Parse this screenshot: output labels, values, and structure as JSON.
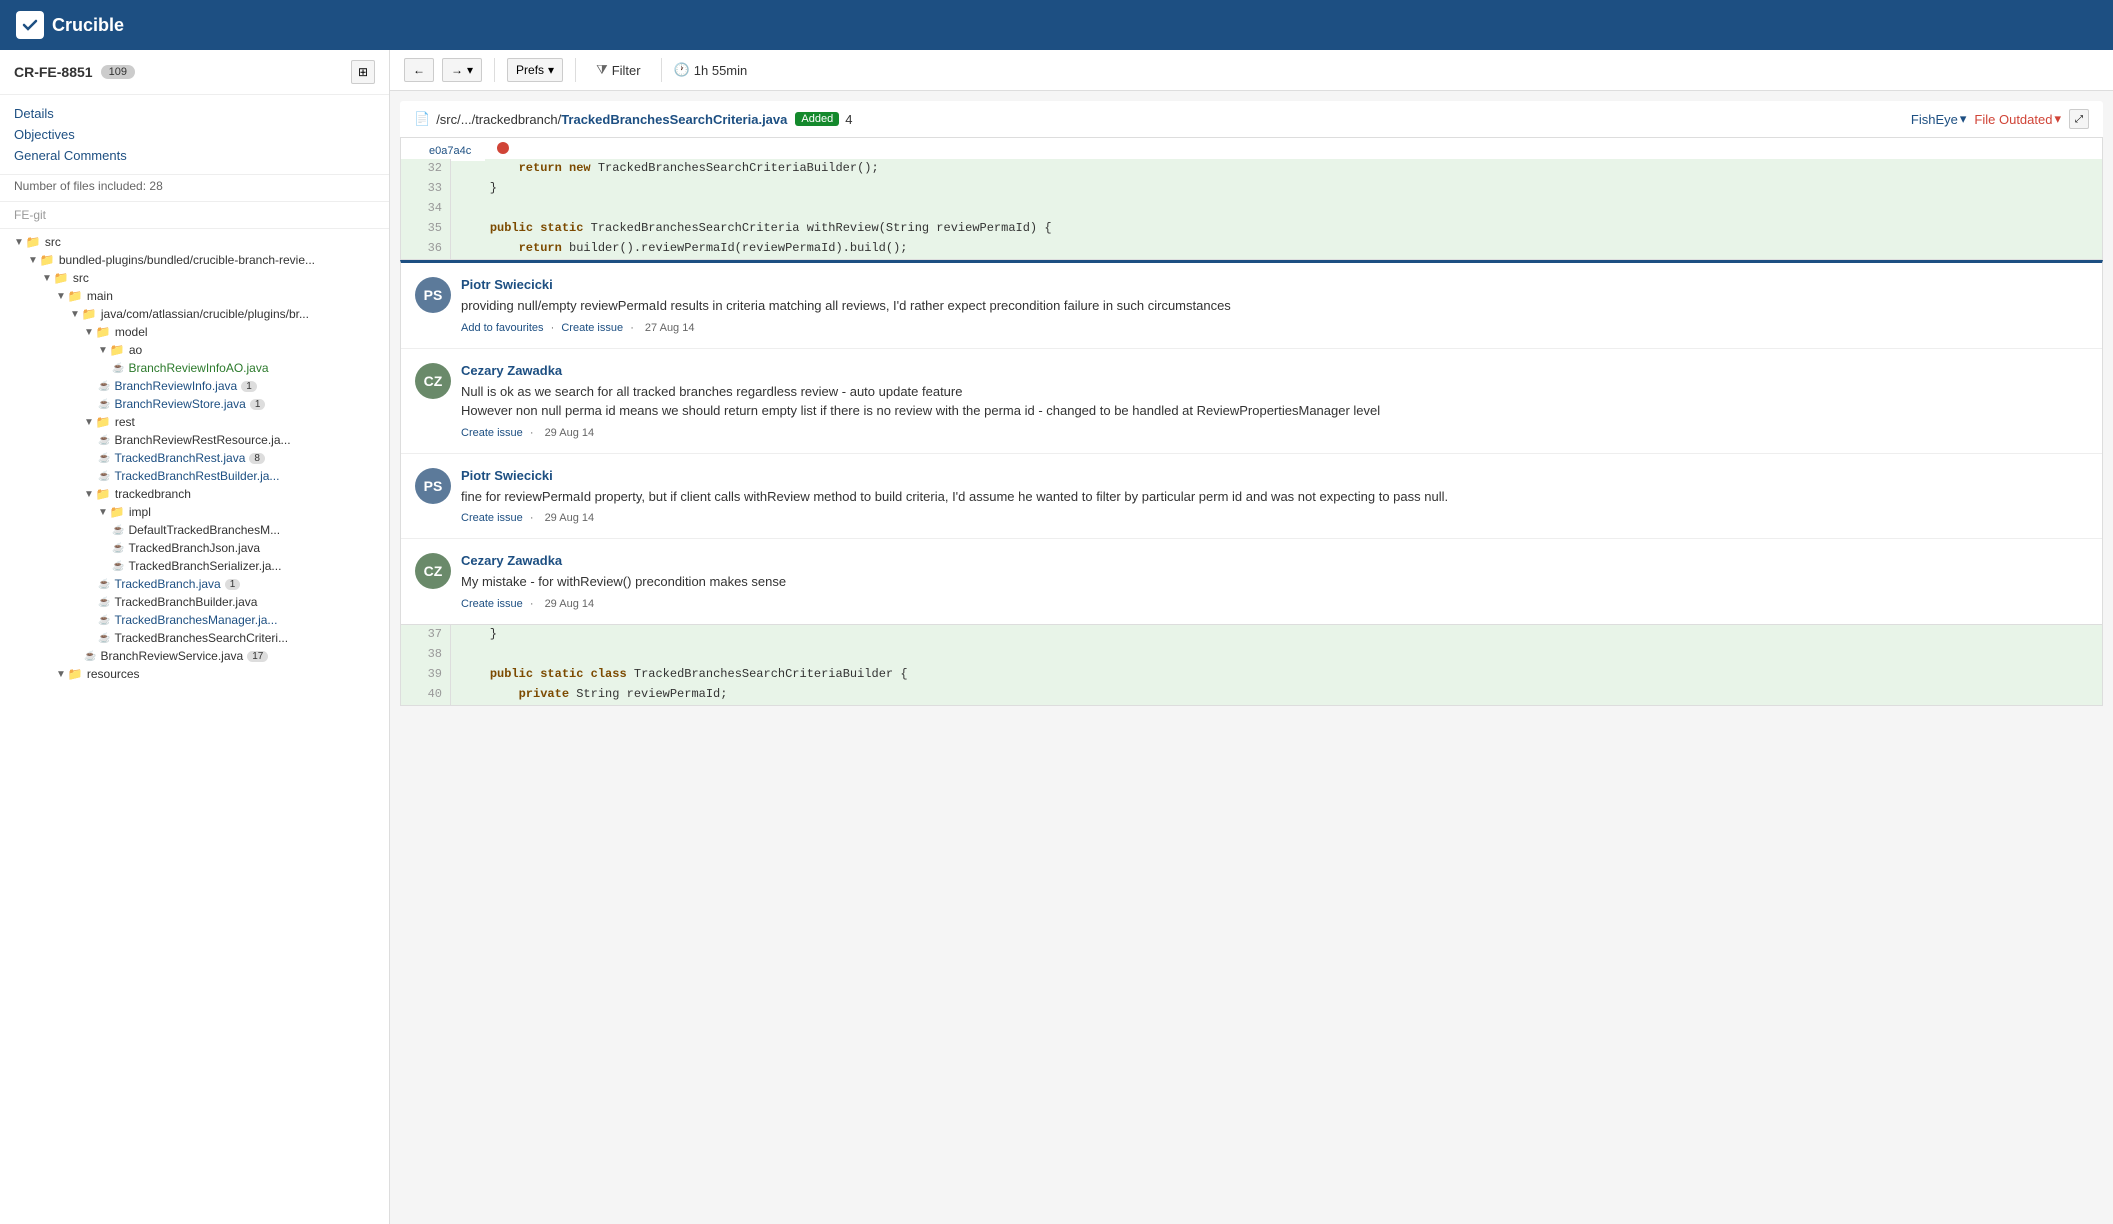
{
  "app": {
    "name": "Crucible",
    "logo_text": "✔"
  },
  "sidebar": {
    "review_id": "CR-FE-8851",
    "review_count": "109",
    "nav_links": [
      {
        "label": "Details",
        "href": "#"
      },
      {
        "label": "Objectives",
        "href": "#"
      },
      {
        "label": "General Comments",
        "href": "#"
      }
    ],
    "meta": "Number of files included: 28",
    "repo": "FE-git",
    "tree": [
      {
        "indent": 1,
        "type": "folder",
        "label": "src",
        "toggle": "▼"
      },
      {
        "indent": 2,
        "type": "folder",
        "label": "bundled-plugins/bundled/crucible-branch-revie...",
        "toggle": "▼"
      },
      {
        "indent": 3,
        "type": "folder",
        "label": "src",
        "toggle": "▼"
      },
      {
        "indent": 4,
        "type": "folder",
        "label": "main",
        "toggle": "▼"
      },
      {
        "indent": 5,
        "type": "folder",
        "label": "java/com/atlassian/crucible/plugins/br...",
        "toggle": "▼"
      },
      {
        "indent": 6,
        "type": "folder",
        "label": "model",
        "toggle": "▼"
      },
      {
        "indent": 7,
        "type": "folder",
        "label": "ao",
        "toggle": "▼"
      },
      {
        "indent": 8,
        "type": "file",
        "label": "BranchReviewInfoAO.java",
        "color": "green",
        "badge": null
      },
      {
        "indent": 7,
        "type": "file",
        "label": "BranchReviewInfo.java",
        "color": "blue",
        "badge": "1"
      },
      {
        "indent": 7,
        "type": "file",
        "label": "BranchReviewStore.java",
        "color": "blue",
        "badge": "1"
      },
      {
        "indent": 6,
        "type": "folder",
        "label": "rest",
        "toggle": "▼"
      },
      {
        "indent": 7,
        "type": "file",
        "label": "BranchReviewRestResource.ja...",
        "color": "default",
        "badge": null
      },
      {
        "indent": 7,
        "type": "file",
        "label": "TrackedBranchRest.java",
        "color": "blue",
        "badge": "8"
      },
      {
        "indent": 7,
        "type": "file",
        "label": "TrackedBranchRestBuilder.ja...",
        "color": "blue",
        "badge": null
      },
      {
        "indent": 6,
        "type": "folder",
        "label": "trackedbranch",
        "toggle": "▼"
      },
      {
        "indent": 7,
        "type": "folder",
        "label": "impl",
        "toggle": "▼"
      },
      {
        "indent": 8,
        "type": "file",
        "label": "DefaultTrackedBranchesM...",
        "color": "default",
        "badge": null
      },
      {
        "indent": 8,
        "type": "file",
        "label": "TrackedBranchJson.java",
        "color": "default",
        "badge": null
      },
      {
        "indent": 8,
        "type": "file",
        "label": "TrackedBranchSerializer.ja...",
        "color": "default",
        "badge": null
      },
      {
        "indent": 7,
        "type": "file",
        "label": "TrackedBranch.java",
        "color": "blue",
        "badge": "1"
      },
      {
        "indent": 7,
        "type": "file",
        "label": "TrackedBranchBuilder.java",
        "color": "default",
        "badge": null
      },
      {
        "indent": 7,
        "type": "file",
        "label": "TrackedBranchesManager.ja...",
        "color": "blue",
        "badge": null
      },
      {
        "indent": 7,
        "type": "file",
        "label": "TrackedBranchesSearchCriteri...",
        "color": "default",
        "badge": null
      },
      {
        "indent": 6,
        "type": "file",
        "label": "BranchReviewService.java",
        "color": "default",
        "badge": "17"
      },
      {
        "indent": 4,
        "type": "folder",
        "label": "resources",
        "toggle": "▼"
      }
    ]
  },
  "toolbar": {
    "prefs_label": "Prefs",
    "filter_label": "Filter",
    "time_label": "1h 55min"
  },
  "file_header": {
    "path_prefix": "/src/.../trackedbranch/",
    "filename": "TrackedBranchesSearchCriteria.java",
    "badge": "Added",
    "count": "4",
    "fisheye_label": "FishEye",
    "file_outdated_label": "File Outdated"
  },
  "commit": {
    "hash": "e0a7a4c"
  },
  "code_lines_top": [
    {
      "num": "32",
      "content": "        return new TrackedBranchesSearchCriteriaBuilder();"
    },
    {
      "num": "33",
      "content": "    }"
    },
    {
      "num": "34",
      "content": ""
    },
    {
      "num": "35",
      "content": "    public static TrackedBranchesSearchCriteria withReview(String reviewPermaId) {"
    },
    {
      "num": "36",
      "content": "        return builder().reviewPermaId(reviewPermaId).build();"
    }
  ],
  "comments": [
    {
      "author": "Piotr Swiecicki",
      "avatar_initials": "PS",
      "avatar_class": "avatar-ps",
      "text": "providing null/empty reviewPermaId results in criteria matching all reviews, I'd rather expect precondition failure in such circumstances",
      "actions": [
        {
          "label": "Add to favourites",
          "type": "link"
        },
        {
          "label": "·",
          "type": "sep"
        },
        {
          "label": "Create issue",
          "type": "link"
        },
        {
          "label": "·",
          "type": "sep"
        },
        {
          "label": "27 Aug 14",
          "type": "text"
        }
      ]
    },
    {
      "author": "Cezary Zawadka",
      "avatar_initials": "CZ",
      "avatar_class": "avatar-cz",
      "text": "Null is ok as we search for all tracked branches regardless review - auto update feature\nHowever non null perma id means we should return empty list if there is no review with the perma id - changed to be handled at ReviewPropertiesManager level",
      "actions": [
        {
          "label": "Create issue",
          "type": "link"
        },
        {
          "label": "·",
          "type": "sep"
        },
        {
          "label": "29 Aug 14",
          "type": "text"
        }
      ]
    },
    {
      "author": "Piotr Swiecicki",
      "avatar_initials": "PS",
      "avatar_class": "avatar-ps",
      "text": "fine for reviewPermaId property, but if client calls withReview method to build criteria, I'd assume he wanted to filter by particular perm id and was not expecting to pass null.",
      "actions": [
        {
          "label": "Create issue",
          "type": "link"
        },
        {
          "label": "·",
          "type": "sep"
        },
        {
          "label": "29 Aug 14",
          "type": "text"
        }
      ]
    },
    {
      "author": "Cezary Zawadka",
      "avatar_initials": "CZ",
      "avatar_class": "avatar-cz",
      "text": "My mistake - for withReview() precondition makes sense",
      "actions": [
        {
          "label": "Create issue",
          "type": "link"
        },
        {
          "label": "·",
          "type": "sep"
        },
        {
          "label": "29 Aug 14",
          "type": "text"
        }
      ]
    }
  ],
  "code_lines_bottom": [
    {
      "num": "37",
      "content": "    }"
    },
    {
      "num": "38",
      "content": ""
    },
    {
      "num": "39",
      "content": "    public static class TrackedBranchesSearchCriteriaBuilder {"
    },
    {
      "num": "40",
      "content": "        private String reviewPermaId;"
    }
  ]
}
